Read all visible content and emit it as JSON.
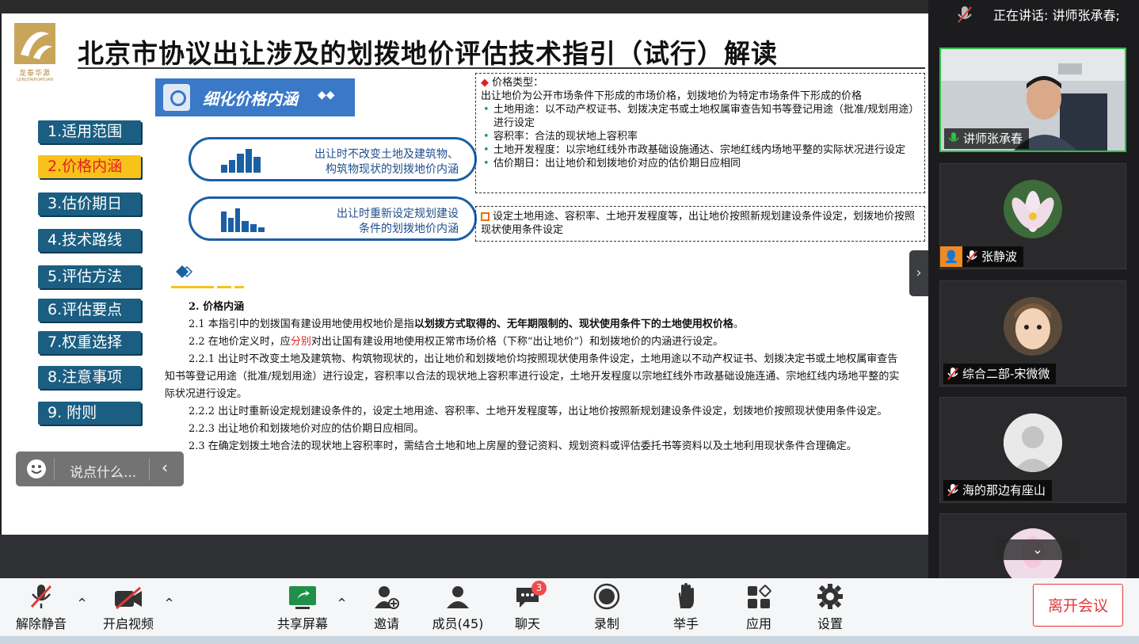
{
  "slide": {
    "logo_text": "龙泰华源",
    "logo_subtext": "LONGTAIHUAYUAN",
    "title": "北京市协议出让涉及的划拨地价评估技术指引（试行）解读",
    "nav": [
      "1.适用范围",
      "2.价格内涵",
      "3.估价期日",
      "4.技术路线",
      "5.评估方法",
      "6.评估要点",
      "7.权重选择",
      "8.注意事项",
      "9.  附则"
    ],
    "active_nav": "2.价格内涵",
    "banner_title": "细化价格内涵",
    "pill1_line1": "出让时不改变土地及建筑物、",
    "pill1_line2": "构筑物现状的划拨地价内涵",
    "pill2_line1": "出让时重新设定规划建设",
    "pill2_line2": "条件的划拨地价内涵",
    "box1": {
      "heading": "价格类型：",
      "intro": "出让地价为公开市场条件下形成的市场价格，划拨地价为特定市场条件下形成的价格",
      "bullets": [
        "土地用途：以不动产权证书、划拨决定书或土地权属审查告知书等登记用途（批准/规划用途）进行设定",
        "容积率：合法的现状地上容积率",
        "土地开发程度：以宗地红线外市政基础设施通达、宗地红线内场地平整的实际状况进行设定",
        "估价期日：出让地价和划拨地价对应的估价期日应相同"
      ]
    },
    "box2_text": "设定土地用途、容积率、土地开发程度等，出让地价按照新规划建设条件设定，划拨地价按照现状使用条件设定",
    "body": {
      "heading": "2. 价格内涵",
      "p21_pre": "2.1 本指引中的划拨国有建设用地使用权地价是指",
      "p21_bold": "以划拨方式取得的、无年期限制的、现状使用条件下的土地使用权价格",
      "p21_post": "。",
      "p22_pre": "2.2 在地价定义时，应",
      "p22_red": "分别",
      "p22_post": "对出让国有建设用地使用权正常市场价格（下称“出让地价”）和划拨地价的内涵进行设定。",
      "p221": "2.2.1 出让时不改变土地及建筑物、构筑物现状的，出让地价和划拨地价均按照现状使用条件设定，土地用途以不动产权证书、划拨决定书或土地权属审查告知书等登记用途（批准/规划用途）进行设定，容积率以合法的现状地上容积率进行设定，土地开发程度以宗地红线外市政基础设施连通、宗地红线内场地平整的实际状况进行设定。",
      "p222": "2.2.2 出让时重新设定规划建设条件的，设定土地用途、容积率、土地开发程度等，出让地价按照新规划建设条件设定，划拨地价按照现状使用条件设定。",
      "p223": "2.2.3 出让地价和划拨地价对应的估价期日应相同。",
      "p23": "2.3 在确定划拨土地合法的现状地上容积率时，需结合土地和地上房屋的登记资料、规划资料或评估委托书等资料以及土地利用现状条件合理确定。"
    },
    "chat_placeholder": "说点什么..."
  },
  "sidebar": {
    "speaking_label": "正在讲话: 讲师张承春;",
    "participants": [
      {
        "name": "讲师张承春",
        "icon": "mic-on-icon"
      },
      {
        "name": "张静波",
        "icon": "mic-muted-icon"
      },
      {
        "name": "综合二部-宋微微",
        "icon": "mic-muted-icon"
      },
      {
        "name": "海的那边有座山",
        "icon": "mic-muted-icon"
      }
    ]
  },
  "toolbar": {
    "unmute": "解除静音",
    "start_video": "开启视频",
    "share_screen": "共享屏幕",
    "invite": "邀请",
    "members": "成员(45)",
    "chat": "聊天",
    "chat_badge": "3",
    "record": "录制",
    "raise_hand": "举手",
    "apps": "应用",
    "settings": "设置",
    "leave": "离开会议"
  },
  "colors": {
    "nav_bg": "#1b5e82",
    "nav_active_bg": "#f7c21a",
    "nav_active_text": "#e02020",
    "accent_blue": "#1b5fa5",
    "leave_red": "#e03a3a",
    "badge_red": "#f24a4a"
  }
}
